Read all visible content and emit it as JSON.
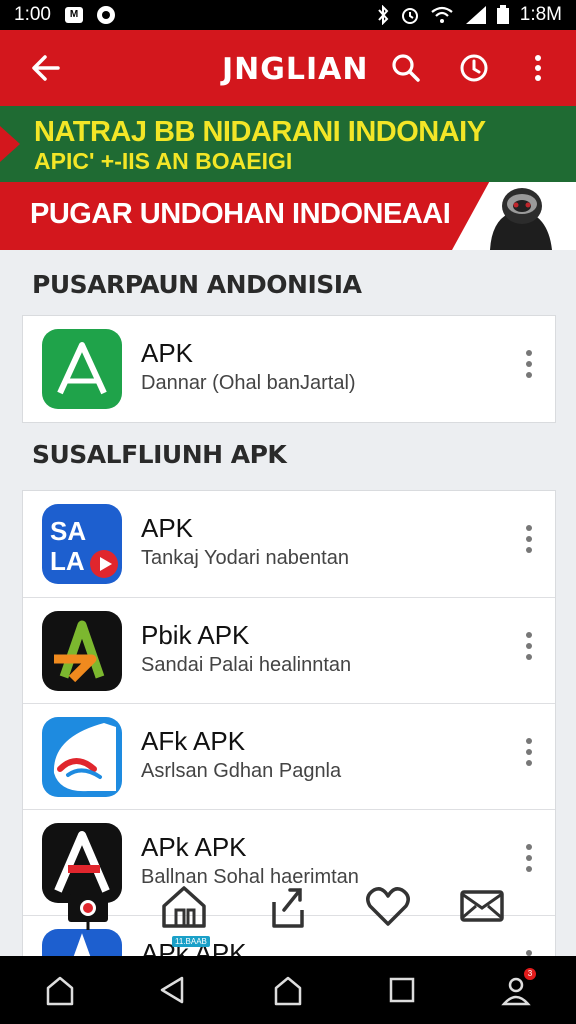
{
  "status_bar": {
    "time": "1:00",
    "right_text": "1:8M",
    "icons": [
      "sim-icon",
      "alert-icon",
      "bluetooth-icon",
      "alarm-icon",
      "wifi-icon",
      "signal-icon",
      "battery-icon"
    ]
  },
  "app_bar": {
    "title": "JNGLIAN",
    "icons": [
      "back-arrow-icon",
      "search-icon",
      "refresh-icon",
      "more-vert-icon"
    ],
    "color": "#d3171d"
  },
  "banner_green": {
    "line1": "NATRAJ BB NIDARANI INDONAIY",
    "line2": "APIC' +-IIS AN BOAEIGI",
    "text_color": "#f3e627",
    "bg_color": "#1f6b33"
  },
  "banner_red": {
    "text": "PUGAR UNDOHAN INDONEAAI",
    "bg_color": "#d3171d"
  },
  "section1": {
    "title": "PUSARPAUN ANDONISIA",
    "items": [
      {
        "name": "APK",
        "desc": "Dannar (Ohal banJartal)",
        "icon": "green-a-icon"
      }
    ]
  },
  "section2": {
    "title": "SUSALFLIUNH APK",
    "items": [
      {
        "name": "APK",
        "desc": "Tankaj Yodari nabentan",
        "icon": "blue-letters-icon"
      },
      {
        "name": "Pbik APK",
        "desc": "Sandai Palai healinntan",
        "icon": "black-a-orange-icon"
      },
      {
        "name": "AFk APK",
        "desc": "Asrlsan Gdhan Pagnla",
        "icon": "blue-swoosh-icon"
      },
      {
        "name": "APk APK",
        "desc": "Ballnan Sohal haerimtan",
        "icon": "black-a-red-icon"
      },
      {
        "name": "APk APK",
        "desc": "",
        "icon": "blue-partial-icon"
      }
    ]
  },
  "bottom_icons": {
    "items": [
      "camera-icon",
      "home-icon",
      "share-icon",
      "heart-icon",
      "mail-icon"
    ],
    "badge": "11.BAAB"
  },
  "nav_bar": {
    "items": [
      "home-icon",
      "back-icon",
      "home-outline-icon",
      "recents-icon",
      "account-icon"
    ],
    "notification_count": "3"
  }
}
